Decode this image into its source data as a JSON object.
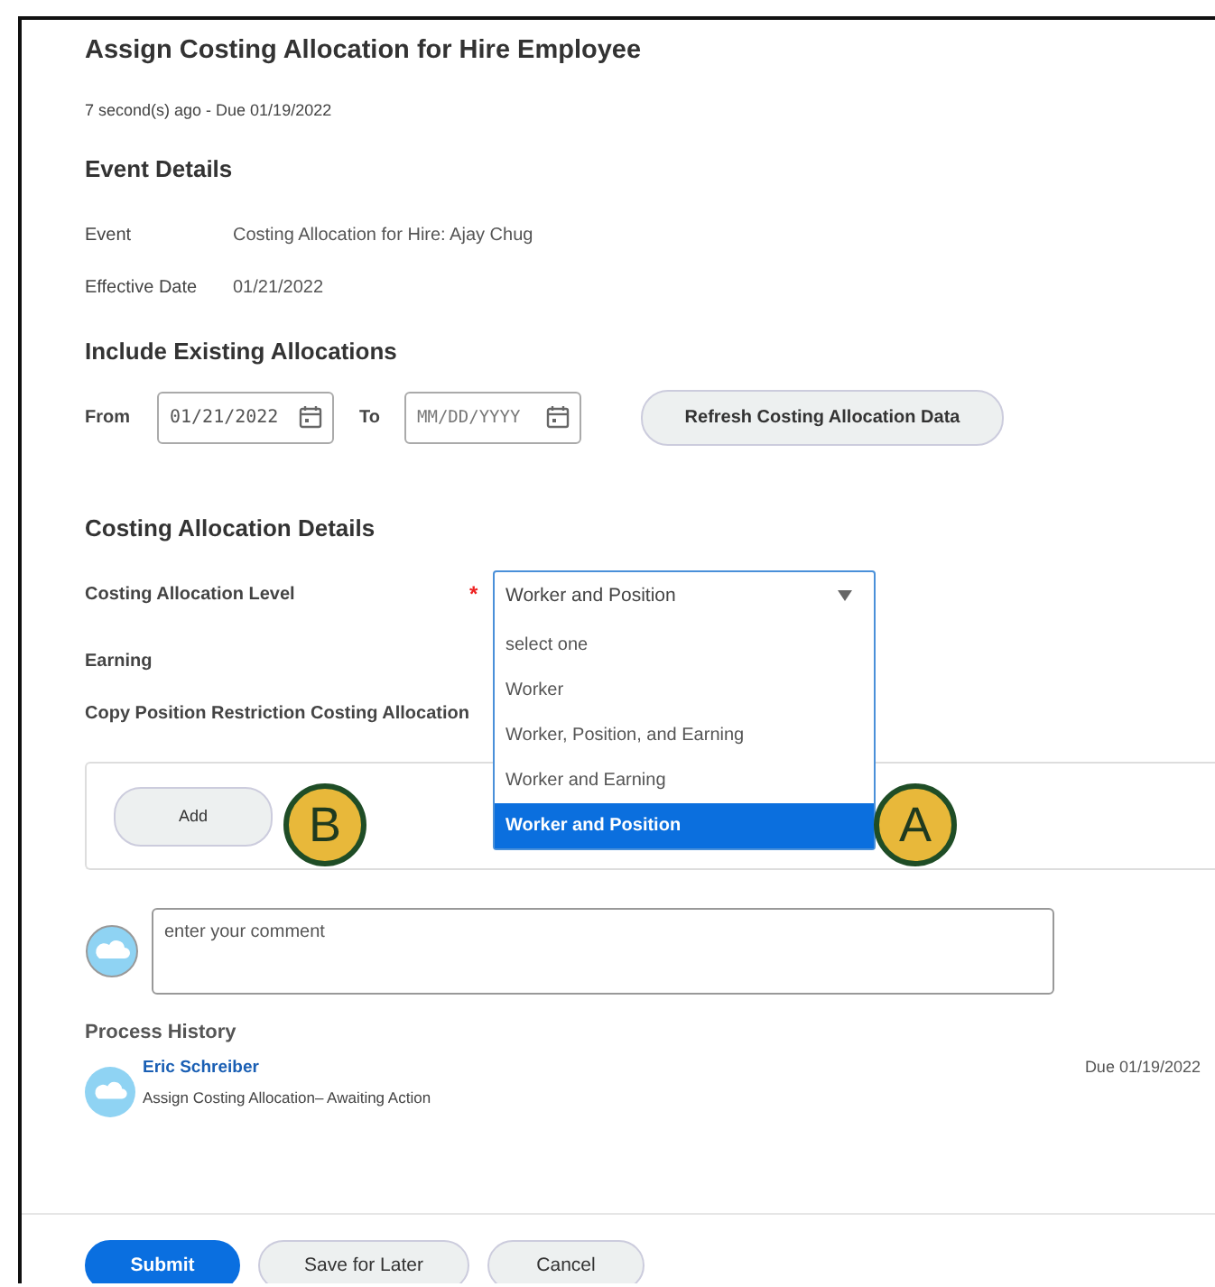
{
  "title": "Assign Costing Allocation for Hire Employee",
  "subtitle": "7 second(s) ago - Due 01/19/2022",
  "event_details": {
    "heading": "Event Details",
    "fields": [
      {
        "label": "Event",
        "value": "Costing Allocation for Hire: Ajay Chug"
      },
      {
        "label": "Effective Date",
        "value": "01/21/2022"
      }
    ]
  },
  "include_existing": {
    "heading": "Include Existing Allocations",
    "from": {
      "label": "From",
      "value": "01/21/2022"
    },
    "to": {
      "label": "To",
      "placeholder": "MM/DD/YYYY"
    },
    "refresh_button": "Refresh Costing Allocation Data"
  },
  "costing_details": {
    "heading": "Costing Allocation Details",
    "fields": [
      {
        "label": "Costing Allocation Level",
        "required_mark": "*"
      },
      {
        "label": "Earning"
      },
      {
        "label": "Copy Position Restriction Costing Allocation"
      }
    ],
    "dropdown": {
      "value": "Worker and Position",
      "options": [
        {
          "label": "select one",
          "selected": false
        },
        {
          "label": "Worker",
          "selected": false
        },
        {
          "label": "Worker, Position, and Earning",
          "selected": false
        },
        {
          "label": "Worker and Earning",
          "selected": false
        },
        {
          "label": "Worker and Position",
          "selected": true
        }
      ]
    }
  },
  "add_button": "Add",
  "callouts": [
    {
      "label": "B"
    },
    {
      "label": "A"
    }
  ],
  "comment": {
    "placeholder": "enter your comment"
  },
  "process_history": {
    "heading": "Process History",
    "entries": [
      {
        "name": "Eric Schreiber",
        "description": "Assign Costing Allocation– Awaiting Action",
        "due": "Due 01/19/2022"
      }
    ]
  },
  "buttons": [
    {
      "label": "Submit",
      "kind": "primary"
    },
    {
      "label": "Save for Later",
      "kind": "secondary"
    },
    {
      "label": "Cancel",
      "kind": "secondary"
    }
  ]
}
